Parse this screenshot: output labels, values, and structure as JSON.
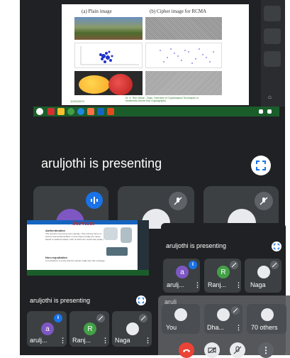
{
  "main_slide": {
    "header_left": "(a) Plain image",
    "header_right": "(b) Cipher image for RCMA",
    "footer": "Dr. K. Ravi Sekar - Topic: Overview of Cryptanalysis Techniques in Multimedia Secret Key Cryptography",
    "footer_date": "11/30/2023"
  },
  "main_presenting_label": "aruljothi is presenting",
  "small_slide": {
    "title": "Services",
    "section1_title": "Authentication",
    "section1_text": "The process of proving one's identity. (The primary forms of host-to-host authentication on the Internet today are name-based or address-based, both of which are notoriously weak.)",
    "section2_title": "Non-repudiation",
    "section2_text": "A mechanism to prove that the sender really sent this message."
  },
  "right_presenting_label": "aruljothi is presenting",
  "left_presenting_label": "aruljothi is presenting",
  "participants_right": [
    {
      "initial": "a",
      "name": "arulj...",
      "color": "#7e57c2"
    },
    {
      "initial": "R",
      "name": "Ranj...",
      "color": "#43a047"
    },
    {
      "initial": "",
      "name": "Naga",
      "color": "#e8eaed"
    }
  ],
  "participants_left": [
    {
      "initial": "a",
      "name": "arulj...",
      "color": "#7e57c2"
    },
    {
      "initial": "R",
      "name": "Ranj...",
      "color": "#43a047"
    },
    {
      "initial": "",
      "name": "Naga",
      "color": "#e8eaed"
    }
  ],
  "overlay": {
    "header_text": "arulj",
    "tiles": [
      {
        "name": "You"
      },
      {
        "name": "Dha..."
      },
      {
        "name": "70 others"
      }
    ]
  },
  "colors": {
    "background": "#202124",
    "tile": "#3c4043",
    "end_call": "#ea4335",
    "speaking": "#1a73e8"
  }
}
